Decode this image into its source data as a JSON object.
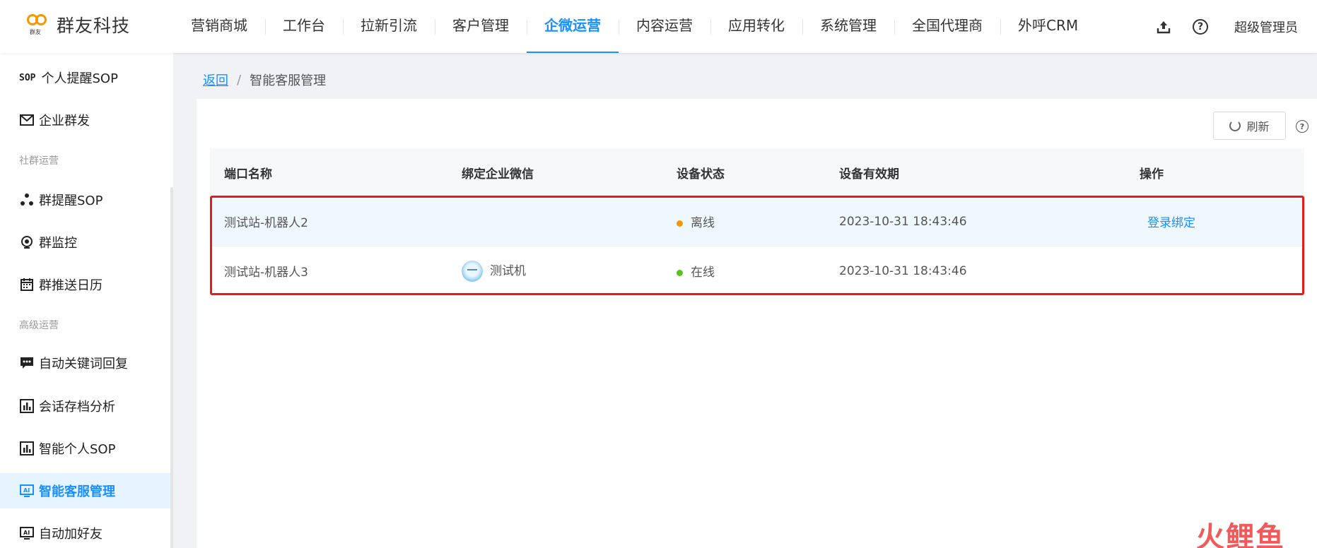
{
  "header": {
    "logo_text": "群友科技",
    "logo_small": "群友",
    "nav": [
      {
        "label": "营销商城"
      },
      {
        "label": "工作台"
      },
      {
        "label": "拉新引流"
      },
      {
        "label": "客户管理"
      },
      {
        "label": "企微运营",
        "active": true
      },
      {
        "label": "内容运营"
      },
      {
        "label": "应用转化"
      },
      {
        "label": "系统管理"
      },
      {
        "label": "全国代理商"
      },
      {
        "label": "外呼CRM"
      }
    ],
    "user": "超级管理员",
    "help_glyph": "?"
  },
  "sidebar": {
    "items": [
      {
        "label": "个人提醒SOP",
        "icon": "sop-icon",
        "icon_text": "SOP"
      },
      {
        "label": "企业群发",
        "icon": "mail-icon"
      },
      {
        "label": "群提醒SOP",
        "icon": "group-sop-icon"
      },
      {
        "label": "群监控",
        "icon": "camera-icon"
      },
      {
        "label": "群推送日历",
        "icon": "calendar-icon"
      },
      {
        "label": "自动关键词回复",
        "icon": "chat-icon"
      },
      {
        "label": "会话存档分析",
        "icon": "chart-icon"
      },
      {
        "label": "智能个人SOP",
        "icon": "chart-icon"
      },
      {
        "label": "智能客服管理",
        "icon": "ai-icon",
        "active": true
      },
      {
        "label": "自动加好友",
        "icon": "ai-icon"
      }
    ],
    "groups": [
      "社群运营",
      "高级运营"
    ]
  },
  "breadcrumb": {
    "back": "返回",
    "separator": "/",
    "current": "智能客服管理"
  },
  "toolbar": {
    "refresh": "刷新",
    "help": "?"
  },
  "table": {
    "columns": [
      "端口名称",
      "绑定企业微信",
      "设备状态",
      "设备有效期",
      "操作"
    ],
    "rows": [
      {
        "name": "测试站-机器人2",
        "wecom": "",
        "status": "离线",
        "status_color": "#f39800",
        "expiry": "2023-10-31 18:43:46",
        "action": "登录绑定"
      },
      {
        "name": "测试站-机器人3",
        "wecom": "测试机",
        "status": "在线",
        "status_color": "#52c41a",
        "expiry": "2023-10-31 18:43:46",
        "action": ""
      }
    ]
  },
  "watermark": "火鲤鱼",
  "colors": {
    "accent": "#1890ff",
    "highlight_border": "#e31b1b"
  }
}
